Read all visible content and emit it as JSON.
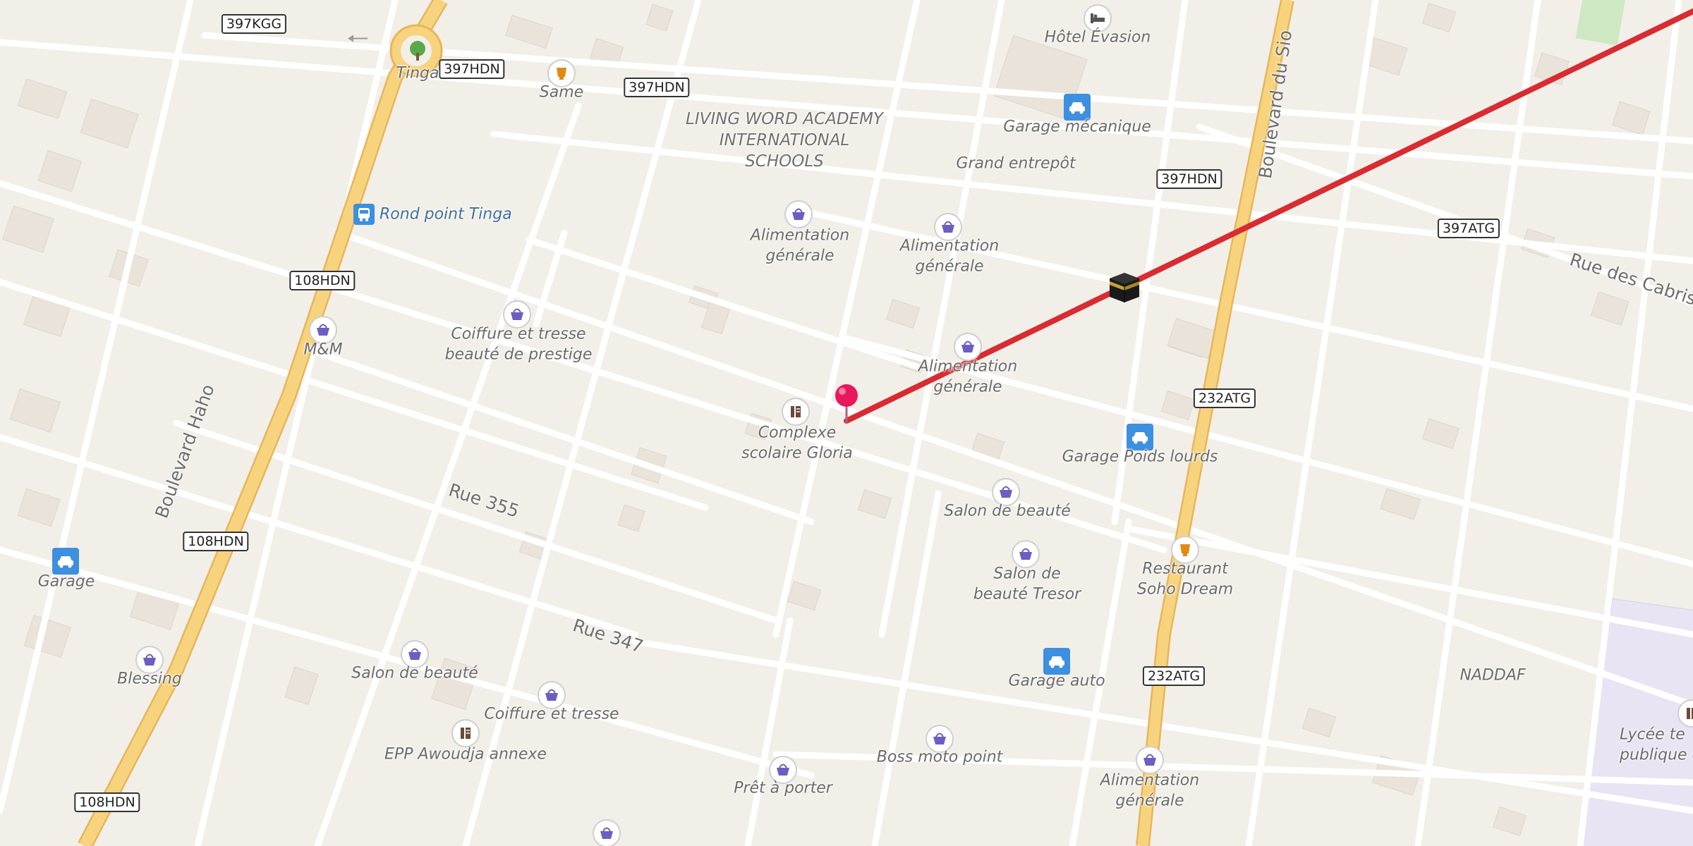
{
  "colors": {
    "background": "#f2efe9",
    "block": "#ebe6de",
    "street": "#ffffff",
    "main_road": "#f7c96a",
    "route": "#d92b32",
    "pin": "#e8185d",
    "shop_icon": "#6a5fc1",
    "garage_icon": "#3d8fe0",
    "restaurant_icon": "#e08a14",
    "school_zone": "#e8e4f3"
  },
  "road_badges": [
    {
      "id": "397kgg",
      "text": "397KGG"
    },
    {
      "id": "397hdn-a",
      "text": "397HDN"
    },
    {
      "id": "397hdn-b",
      "text": "397HDN"
    },
    {
      "id": "397hdn-c",
      "text": "397HDN"
    },
    {
      "id": "397atg",
      "text": "397ATG"
    },
    {
      "id": "108hdn-a",
      "text": "108HDN"
    },
    {
      "id": "108hdn-b",
      "text": "108HDN"
    },
    {
      "id": "108hdn-c",
      "text": "108HDN"
    },
    {
      "id": "232atg-a",
      "text": "232ATG"
    },
    {
      "id": "232atg-b",
      "text": "232ATG"
    }
  ],
  "street_labels": {
    "boulevard_haho": "Boulevard Haho",
    "boulevard_du_sio": "Boulevard du Sio",
    "rue_355": "Rue 355",
    "rue_347": "Rue 347",
    "rue_des_cabris": "Rue des Cabris"
  },
  "places": {
    "tinga": "Tinga",
    "same": "Same",
    "hotel_evasion": "Hôtel Évasion",
    "garage_mecanique": "Garage mécanique",
    "living_word": "LIVING WORD ACADEMY\nINTERNATIONAL\nSCHOOLS",
    "grand_entrepot": "Grand entrepôt",
    "rond_point_tinga": "Rond point Tinga",
    "alimentation_1": "Alimentation\ngénérale",
    "alimentation_2": "Alimentation\ngénérale",
    "alimentation_3": "Alimentation\ngénérale",
    "alimentation_4": "Alimentation\ngénérale",
    "coiffure_prestige": "Coiffure et tresse\nbeauté de prestige",
    "mm": "M&M",
    "complexe_gloria": "Complexe\nscolaire Gloria",
    "garage_poids_lourds": "Garage Poids lourds",
    "salon_beaute_1": "Salon de beauté",
    "salon_beaute_tresor": "Salon de\nbeauté Tresor",
    "restaurant_soho": "Restaurant\nSoho Dream",
    "garage": "Garage",
    "blessing": "Blessing",
    "salon_beaute_2": "Salon de beauté",
    "coiffure_tresse": "Coiffure et tresse",
    "epp_awoudja": "EPP Awoudja annexe",
    "garage_auto": "Garage auto",
    "naddaf": "NADDAF",
    "boss_moto": "Boss moto point",
    "pret_a_porter": "Prêt à porter",
    "lycee": "Lycée te\npublique d"
  }
}
